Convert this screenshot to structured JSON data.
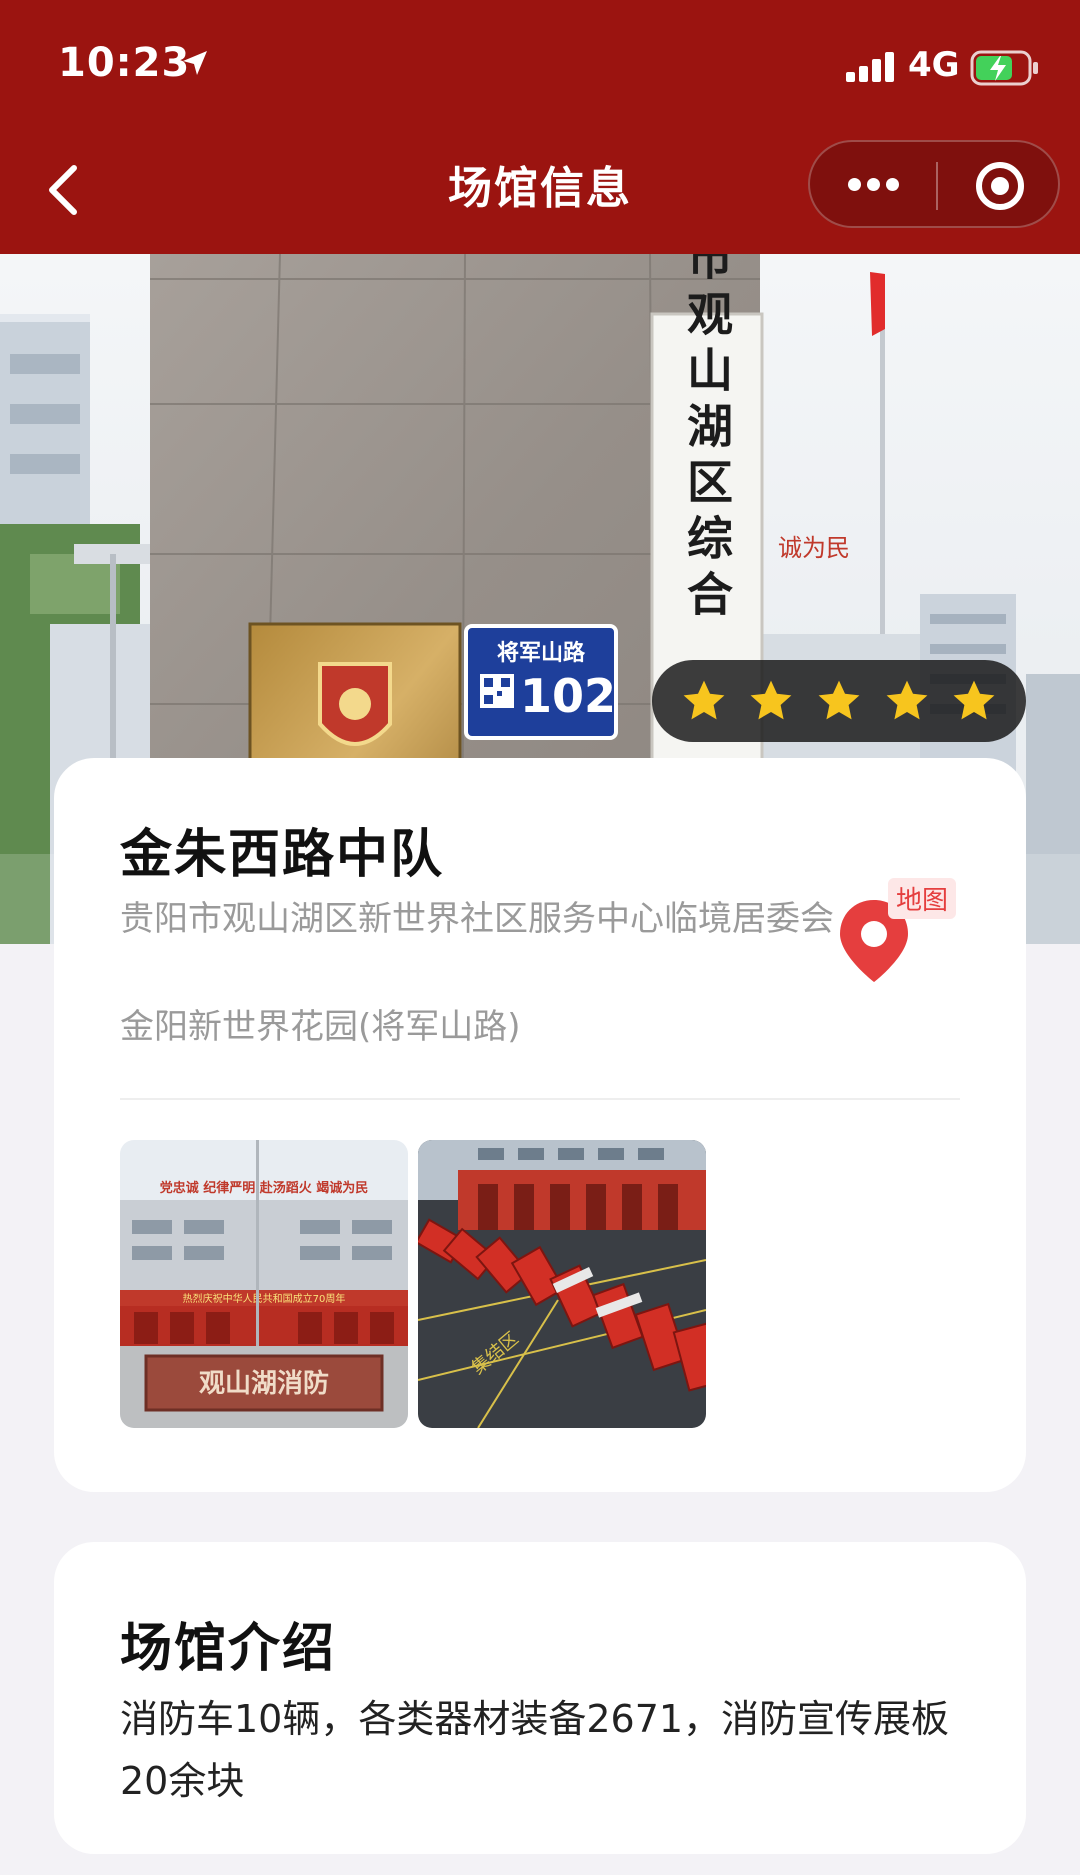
{
  "status_bar": {
    "time": "10:23",
    "network": "4G"
  },
  "nav": {
    "title": "场馆信息"
  },
  "hero": {
    "sign_text": "贵阳市观山湖区综合",
    "slogan_text": "诚为民",
    "plate_road": "将军山路",
    "plate_number": "102",
    "rating_stars": 5,
    "rating_max": 5
  },
  "venue": {
    "name": "金朱西路中队",
    "address_line1": "贵阳市观山湖区新世界社区服务中心临境居委会",
    "address_line2": "金阳新世界花园(将军山路)",
    "map_label": "地图"
  },
  "gallery": {
    "photo1_banner": "党忠诚   纪律严明   赴汤蹈火   竭诚为民",
    "photo1_stone": "观山湖消防",
    "photo1_strip": "热烈庆祝中华人民共和国成立70周年",
    "photo2_ground": "集结区"
  },
  "intro": {
    "title": "场馆介绍",
    "text": "消防车10辆，各类器材装备2671，消防宣传展板20余块"
  },
  "colors": {
    "brand": "#9b1410",
    "star": "#f7c51e",
    "map_pin": "#e53e3e"
  }
}
